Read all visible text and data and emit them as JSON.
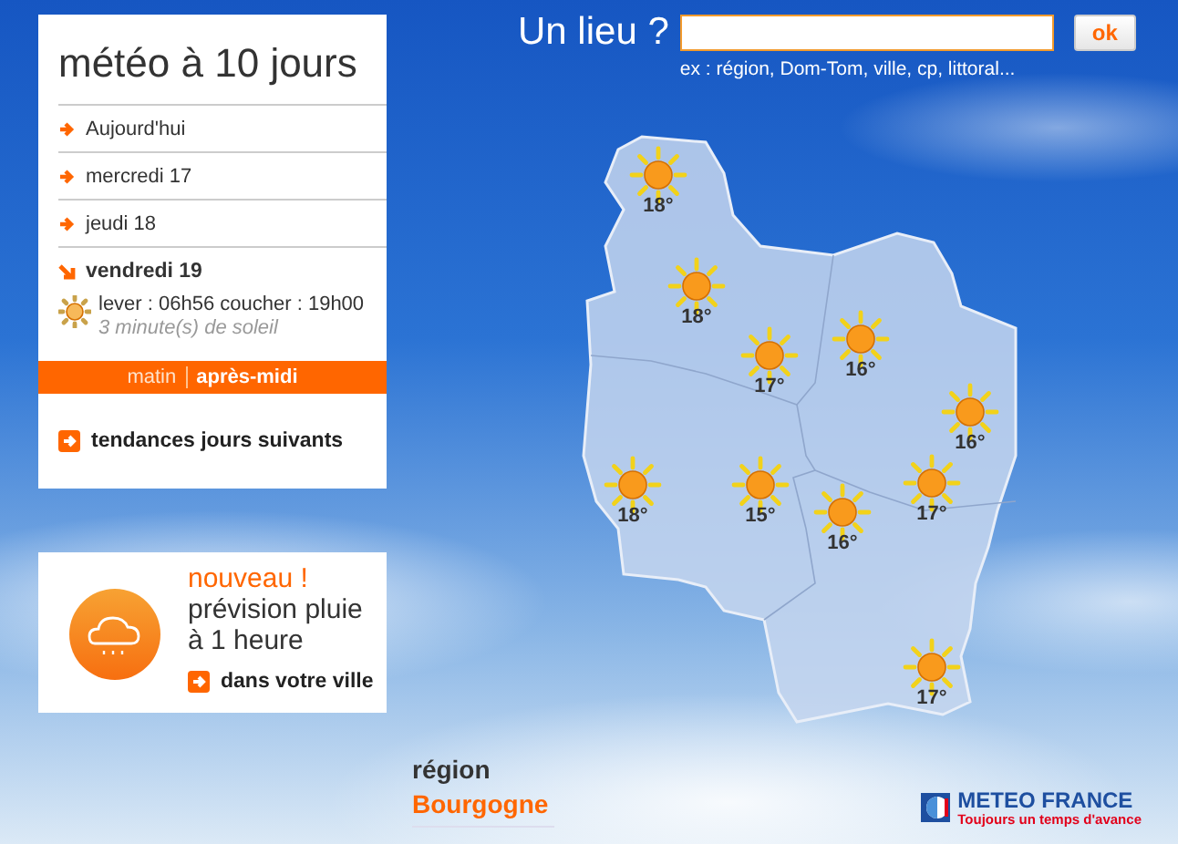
{
  "panel": {
    "title": "météo à 10 jours",
    "days": [
      {
        "label": "Aujourd'hui",
        "selected": false
      },
      {
        "label": "mercredi 17",
        "selected": false
      },
      {
        "label": "jeudi 18",
        "selected": false
      },
      {
        "label": "vendredi 19",
        "selected": true
      }
    ],
    "sun_times": "lever : 06h56 coucher : 19h00",
    "sunshine": "3 minute(s) de soleil",
    "periods": [
      {
        "label": "matin",
        "selected": false
      },
      {
        "label": "après-midi",
        "selected": true
      }
    ],
    "trends_link": "tendances jours suivants"
  },
  "promo": {
    "badge": "nouveau !",
    "title": "prévision pluie à 1 heure",
    "link": "dans votre ville"
  },
  "search": {
    "label": "Un lieu ?",
    "button": "ok",
    "hint": "ex : région, Dom-Tom, ville, cp, littoral..."
  },
  "map": {
    "markers": [
      {
        "kind": "sun",
        "temperature": "18°"
      },
      {
        "kind": "sun",
        "temperature": "18°"
      },
      {
        "kind": "sun",
        "temperature": "17°"
      },
      {
        "kind": "sun",
        "temperature": "16°"
      },
      {
        "kind": "sun",
        "temperature": "16°"
      },
      {
        "kind": "sun",
        "temperature": "18°"
      },
      {
        "kind": "sun",
        "temperature": "15°"
      },
      {
        "kind": "sun",
        "temperature": "16°"
      },
      {
        "kind": "sun",
        "temperature": "17°"
      },
      {
        "kind": "sun",
        "temperature": "17°"
      }
    ]
  },
  "region": {
    "label": "région",
    "name": "Bourgogne"
  },
  "logo": {
    "name": "METEO FRANCE",
    "slogan": "Toujours un temps d'avance"
  }
}
